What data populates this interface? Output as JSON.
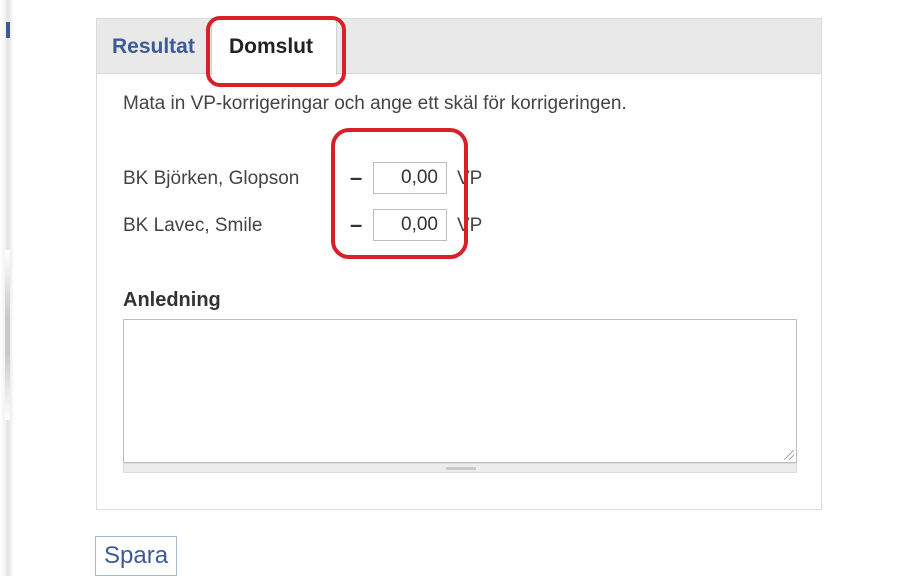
{
  "tabs": {
    "resultat_label": "Resultat",
    "domslut_label": "Domslut"
  },
  "domslut": {
    "instruction": "Mata in VP-korrigeringar och ange ett skäl för korrigeringen.",
    "teams": [
      {
        "name": "BK Björken, Glopson",
        "minus": "–",
        "value": "0,00",
        "unit": "VP"
      },
      {
        "name": "BK Lavec, Smile",
        "minus": "–",
        "value": "0,00",
        "unit": "VP"
      }
    ],
    "reason_label": "Anledning",
    "reason_value": ""
  },
  "actions": {
    "save_label": "Spara"
  },
  "colors": {
    "accent": "#3d5a98",
    "highlight": "#d9202a",
    "tab_bar": "#e9e9e9"
  }
}
